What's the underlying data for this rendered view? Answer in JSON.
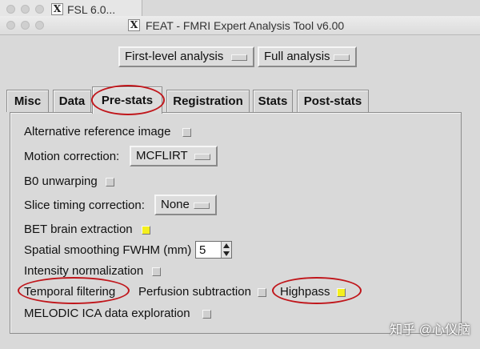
{
  "back_window": {
    "title": "FSL 6.0...",
    "app_icon": "x11-icon"
  },
  "window": {
    "title": "FEAT - FMRI Expert Analysis Tool v6.00",
    "app_icon": "x11-icon"
  },
  "top_selectors": {
    "analysis_level": "First-level analysis",
    "analysis_type": "Full analysis"
  },
  "tabs": [
    {
      "label": "Misc",
      "active": false
    },
    {
      "label": "Data",
      "active": false
    },
    {
      "label": "Pre-stats",
      "active": true
    },
    {
      "label": "Registration",
      "active": false
    },
    {
      "label": "Stats",
      "active": false
    },
    {
      "label": "Post-stats",
      "active": false
    }
  ],
  "prestats": {
    "alt_ref_label": "Alternative reference image",
    "alt_ref_checked": false,
    "motion_label": "Motion correction:",
    "motion_value": "MCFLIRT",
    "b0_label": "B0 unwarping",
    "b0_checked": false,
    "slice_label": "Slice timing correction:",
    "slice_value": "None",
    "bet_label": "BET brain extraction",
    "bet_checked": true,
    "smoothing_label": "Spatial smoothing FWHM (mm)",
    "smoothing_value": "5",
    "intensity_label": "Intensity normalization",
    "intensity_checked": false,
    "temporal_label": "Temporal filtering",
    "perfusion_label": "Perfusion subtraction",
    "perfusion_checked": false,
    "highpass_label": "Highpass",
    "highpass_checked": true,
    "melodic_label": "MELODIC ICA data exploration",
    "melodic_checked": false
  },
  "annotation_color": "#c0161b",
  "checked_color": "#f4ef1e",
  "watermark": "知乎 @心仪脑"
}
